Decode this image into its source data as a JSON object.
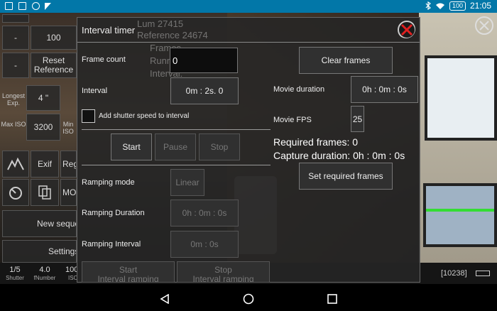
{
  "status_bar": {
    "time": "21:05",
    "battery": "100"
  },
  "background_panel": {
    "info_lines": [
      "Lum 27415",
      "Reference 24674",
      "Frames",
      "Running:",
      "Interval:"
    ],
    "row1": [
      "-",
      "100"
    ],
    "row2": [
      "-",
      "Reset Reference"
    ],
    "longest_exp_label": "Longest Exp.",
    "longest_exp_value": "4 \"",
    "max_iso_label": "Max ISO",
    "max_iso_value": "3200",
    "min_iso_label": "Min ISO",
    "exif": "Exif",
    "regi": "Regi",
    "mode": "MOD",
    "new_sequence": "New sequence",
    "settings": "Settings",
    "shutter_value": "1/5",
    "shutter_label": "Shutter",
    "fnumber_value": "4.0",
    "fnumber_label": "fNumber",
    "iso_value": "100",
    "iso_label": "ISO",
    "counter": "[10238]"
  },
  "dialog": {
    "title": "Interval timer",
    "frame_count_label": "Frame count",
    "frame_count_value": "0",
    "clear_frames": "Clear frames",
    "interval_label": "Interval",
    "interval_value": "0m : 2s. 0",
    "movie_duration_label": "Movie duration",
    "movie_duration_value": "0h : 0m : 0s",
    "add_shutter_label": "Add shutter speed to interval",
    "add_shutter_checked": false,
    "movie_fps_label": "Movie FPS",
    "movie_fps_value": "25",
    "start": "Start",
    "pause": "Pause",
    "stop": "Stop",
    "required_frames": "Required frames: 0",
    "capture_duration": "Capture duration: 0h : 0m : 0s",
    "set_required_frames": "Set required frames",
    "ramping_mode_label": "Ramping mode",
    "ramping_mode_value": "Linear",
    "ramping_duration_label": "Ramping Duration",
    "ramping_duration_value": "0h : 0m : 0s",
    "ramping_interval_label": "Ramping Interval",
    "ramping_interval_value": "0m : 0s",
    "start_interval_ramping_1": "Start",
    "start_interval_ramping_2": "Interval ramping",
    "stop_interval_ramping_1": "Stop",
    "stop_interval_ramping_2": "Interval ramping"
  },
  "colors": {
    "status_bar": "#0277a8",
    "close_icon": "#e02020"
  },
  "icons": [
    "image-icon",
    "gallery-icon",
    "download-icon",
    "bluetooth-icon",
    "wifi-icon",
    "mountain-icon",
    "timer-icon",
    "copy-icon",
    "close-icon",
    "back-icon",
    "home-icon",
    "recents-icon",
    "battery-icon"
  ]
}
